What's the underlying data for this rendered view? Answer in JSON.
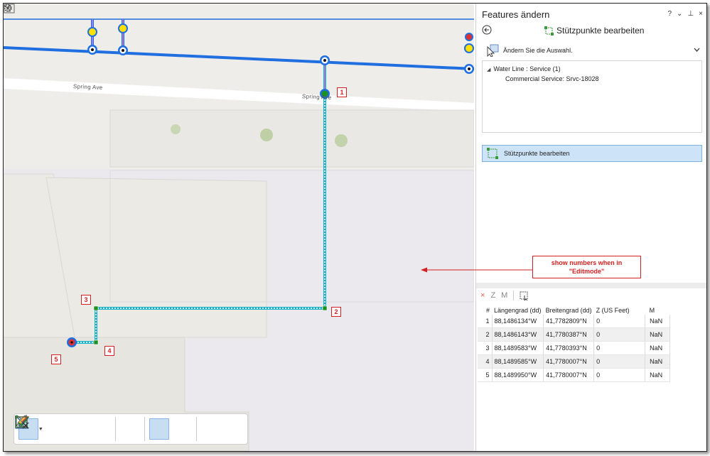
{
  "map": {
    "street_label_1": "Spring Ave",
    "street_label_2": "Spring Ave",
    "vertex_numbers": [
      "1",
      "2",
      "3",
      "4",
      "5"
    ],
    "toolbar": {
      "tools": [
        "select-tool",
        "select-dropdown",
        "add-vertex-tool",
        "remove-vertex-tool",
        "sketch-tool",
        "reshape-tool",
        "finish-tool",
        "cut-tool",
        "finish-sketch-tool",
        "discard-sketch-tool"
      ]
    }
  },
  "pane": {
    "title": "Features ändern",
    "controls": [
      "?",
      "⌄",
      "⊥",
      "×"
    ],
    "subtitle": "Stützpunkte bearbeiten",
    "selection_label": "Ändern Sie die Auswahl.",
    "tree": {
      "layer": "Water Line : Service (1)",
      "feature": "Commercial Service: Srvc-18028"
    },
    "edit_vertices_label": "Stützpunkte bearbeiten",
    "grid_tools": [
      "×",
      "Z",
      "M"
    ],
    "table": {
      "headers": [
        "#",
        "Längengrad (dd)",
        "Breitengrad (dd)",
        "Z (US Feet)",
        "M"
      ],
      "rows": [
        [
          "1",
          "88,1486134°W",
          "41,7782809°N",
          "0",
          "NaN"
        ],
        [
          "2",
          "88,1486143°W",
          "41,7780387°N",
          "0",
          "NaN"
        ],
        [
          "3",
          "88,1489583°W",
          "41,7780393°N",
          "0",
          "NaN"
        ],
        [
          "4",
          "88,1489585°W",
          "41,7780007°N",
          "0",
          "NaN"
        ],
        [
          "5",
          "88,1489950°W",
          "41,7780007°N",
          "0",
          "NaN"
        ]
      ]
    }
  },
  "annotation": {
    "callout_line1": "show numbers when in",
    "callout_line2": "\"Editmode\""
  },
  "colors": {
    "accent": "#d42020",
    "water_main": "#1f6fe0",
    "selection": "#cde3f7"
  }
}
